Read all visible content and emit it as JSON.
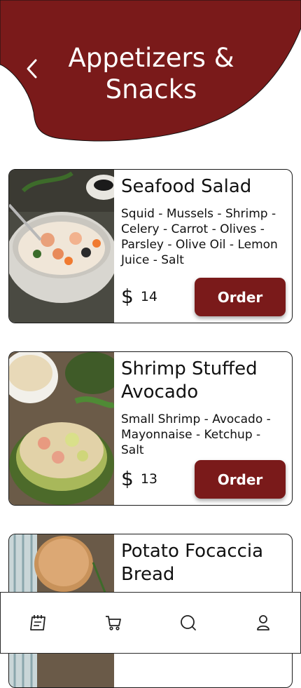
{
  "header": {
    "title_line1": "Appetizers &",
    "title_line2": "Snacks",
    "bg_color": "#7a1a1a",
    "back_icon": "chevron-left-icon"
  },
  "menu": {
    "items": [
      {
        "title": "Seafood Salad",
        "description": "Squid - Mussels - Shrimp - Celery - Carrot - Olives - Parsley - Olive Oil - Lemon Juice - Salt",
        "currency": "$",
        "price": "14",
        "order_label": "Order"
      },
      {
        "title": "Shrimp Stuffed Avocado",
        "description": "Small Shrimp - Avocado - Mayonnaise - Ketchup - Salt",
        "currency": "$",
        "price": "13",
        "order_label": "Order"
      },
      {
        "title": "Potato Focaccia Bread"
      }
    ]
  },
  "tabbar": {
    "tabs": [
      "menu-icon",
      "cart-icon",
      "search-icon",
      "profile-icon"
    ]
  },
  "colors": {
    "accent": "#7a1a1a"
  }
}
